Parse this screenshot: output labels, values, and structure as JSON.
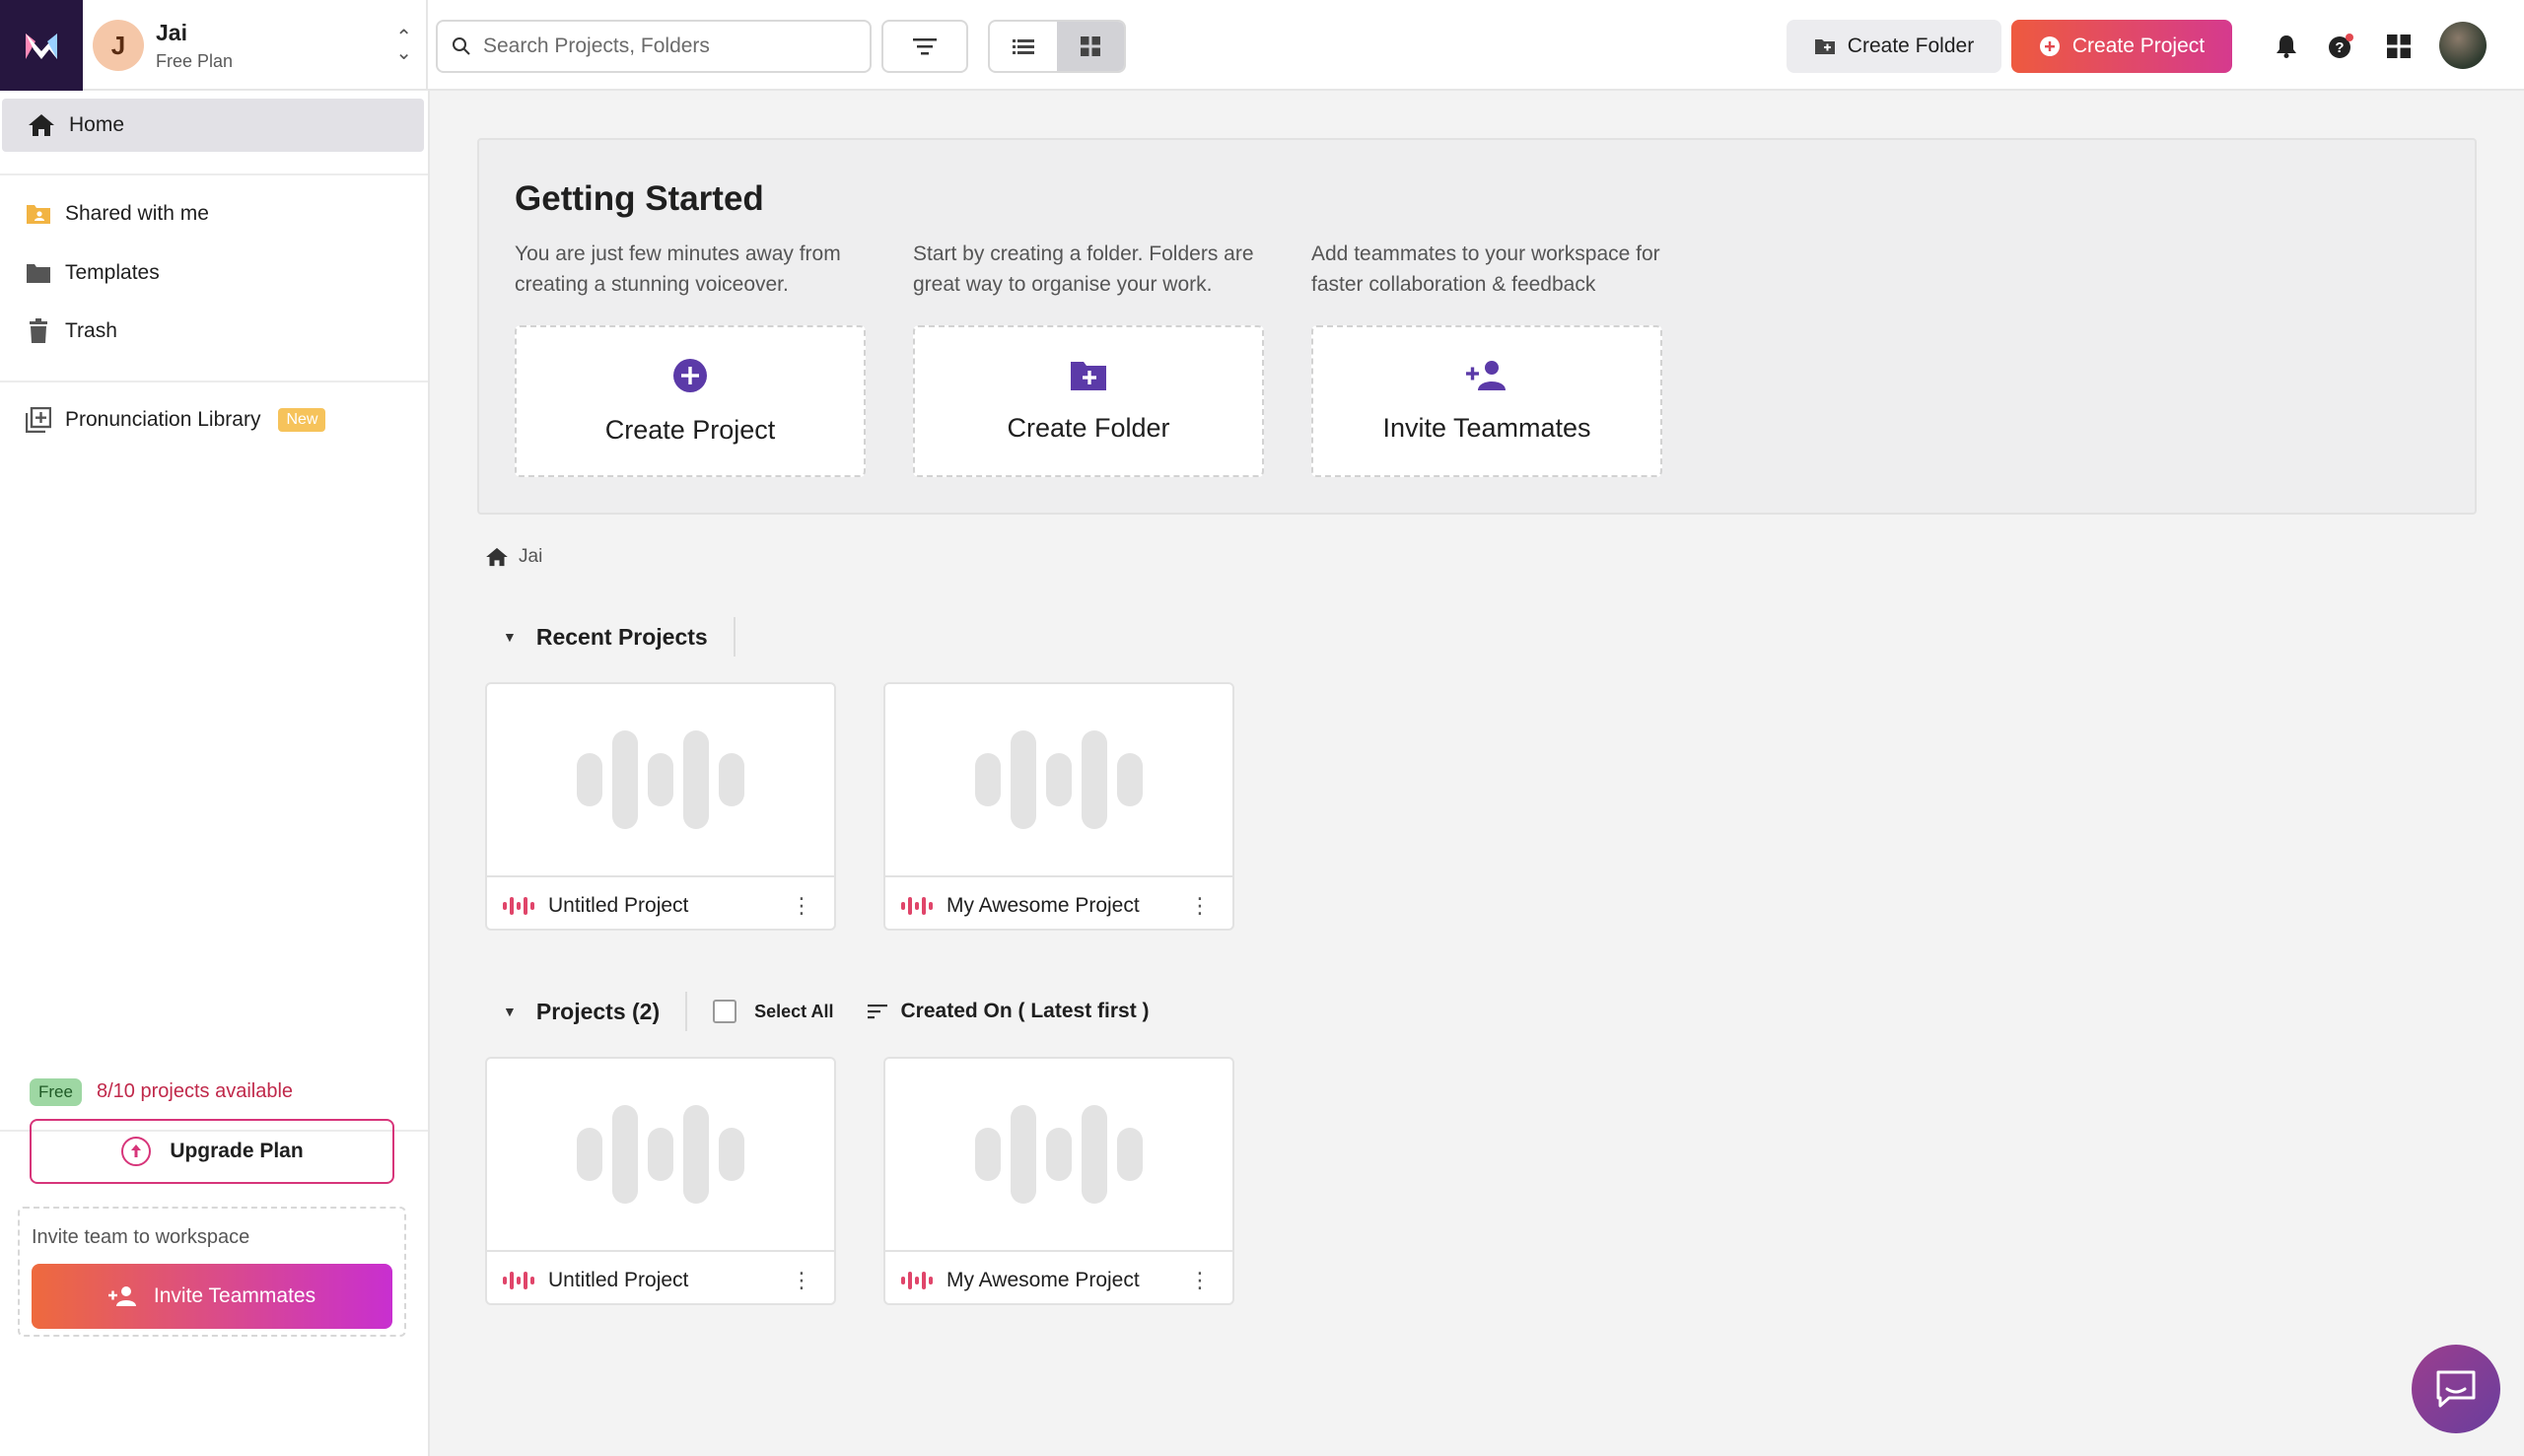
{
  "workspace": {
    "initial": "J",
    "name": "Jai",
    "plan": "Free Plan"
  },
  "search": {
    "placeholder": "Search Projects, Folders"
  },
  "toolbar": {
    "create_folder": "Create Folder",
    "create_project": "Create Project",
    "view_mode": "grid"
  },
  "sidebar": {
    "items": [
      {
        "label": "Home",
        "icon": "home-icon",
        "active": true
      },
      {
        "label": "Shared with me",
        "icon": "shared-folder-icon"
      },
      {
        "label": "Templates",
        "icon": "folder-icon"
      },
      {
        "label": "Trash",
        "icon": "trash-icon"
      },
      {
        "label": "Pronunciation Library",
        "icon": "library-icon",
        "badge": "New"
      }
    ],
    "footer": {
      "plan_badge": "Free",
      "availability": "8/10 projects available",
      "upgrade_label": "Upgrade Plan",
      "invite_text": "Invite team to workspace",
      "invite_button": "Invite Teammates"
    }
  },
  "getting_started": {
    "title": "Getting Started",
    "cards": [
      {
        "description": "You are just few minutes away from creating a stunning voiceover.",
        "label": "Create Project",
        "icon": "plus-circle-icon"
      },
      {
        "description": "Start by creating a folder. Folders are great way to organise your work.",
        "label": "Create Folder",
        "icon": "folder-plus-icon"
      },
      {
        "description": "Add teammates to your workspace for faster collaboration & feedback",
        "label": "Invite Teammates",
        "icon": "person-add-icon"
      }
    ]
  },
  "breadcrumb": {
    "label": "Jai"
  },
  "recent": {
    "title": "Recent Projects",
    "projects": [
      {
        "name": "Untitled Project"
      },
      {
        "name": "My Awesome Project"
      }
    ]
  },
  "projects": {
    "title": "Projects (2)",
    "select_all": "Select All",
    "sort": "Created On ( Latest first )",
    "items": [
      {
        "name": "Untitled Project"
      },
      {
        "name": "My Awesome Project"
      }
    ]
  },
  "colors": {
    "brand_gradient_start": "#ee5a3f",
    "brand_gradient_end": "#d53a8e",
    "accent_purple": "#6a3bb5",
    "logo_bg": "#26163f"
  }
}
